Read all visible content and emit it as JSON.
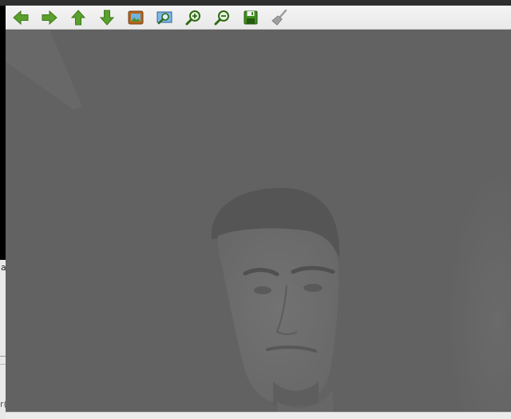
{
  "toolbar": {
    "buttons": [
      {
        "name": "back-button",
        "icon": "arrow-left-icon",
        "color": "#5aa02c"
      },
      {
        "name": "forward-button",
        "icon": "arrow-right-icon",
        "color": "#5aa02c"
      },
      {
        "name": "up-button",
        "icon": "arrow-up-icon",
        "color": "#5aa02c"
      },
      {
        "name": "down-button",
        "icon": "arrow-down-icon",
        "color": "#5aa02c"
      },
      {
        "name": "home-button",
        "icon": "picture-frame-icon",
        "color": "#b5651d"
      },
      {
        "name": "zoom-fit-button",
        "icon": "zoom-to-rect-icon",
        "color": "#3b7fc4"
      },
      {
        "name": "zoom-in-button",
        "icon": "zoom-in-icon",
        "color": "#2e6b12"
      },
      {
        "name": "zoom-out-button",
        "icon": "zoom-out-icon",
        "color": "#2e6b12"
      },
      {
        "name": "save-button",
        "icon": "save-disk-icon",
        "color": "#3f8f1f"
      },
      {
        "name": "clear-button",
        "icon": "broom-icon",
        "color": "#888888"
      }
    ]
  },
  "background_glyphs": {
    "left_char_1": "a",
    "left_char_2": "r("
  },
  "canvas": {
    "description_colors": {
      "background": "#626262",
      "face": "#6e6e6e",
      "hair": "#4f4f4f"
    }
  }
}
